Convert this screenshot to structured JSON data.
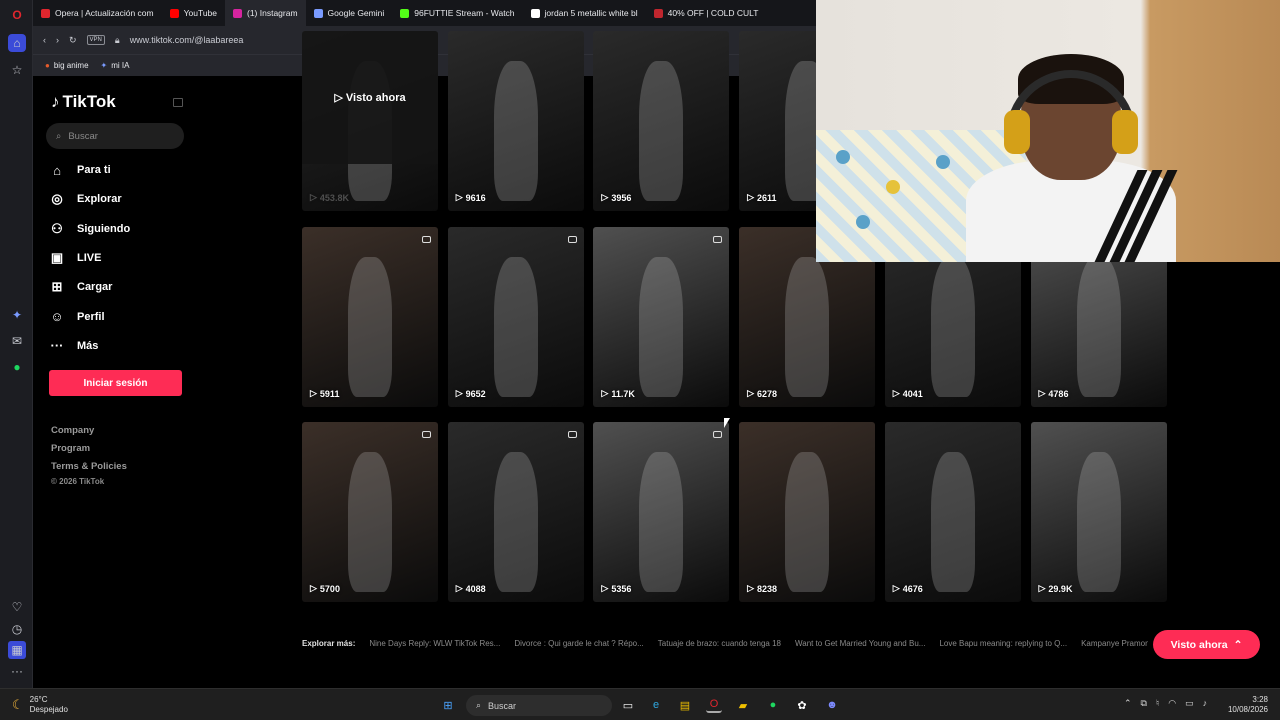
{
  "browser": {
    "tabs": [
      {
        "title": "Opera | Actualización com",
        "color": "#e0262e"
      },
      {
        "title": "YouTube",
        "color": "#ff0000"
      },
      {
        "title": "(1) Instagram",
        "color": "#d6249f"
      },
      {
        "title": "Google Gemini",
        "color": "#7a9bff"
      },
      {
        "title": "96FUTTIE Stream - Watch",
        "color": "#53fc18"
      },
      {
        "title": "jordan 5 metallic white bl",
        "color": "#ffffff"
      },
      {
        "title": "40% OFF | COLD CULT",
        "color": "#c0262e"
      }
    ],
    "url": "www.tiktok.com/@laabareea",
    "vpn_label": "VPN",
    "bookmarks": [
      "big anime",
      "mi IA"
    ]
  },
  "tiktok": {
    "logo": "TikTok",
    "search_placeholder": "Buscar",
    "nav": [
      {
        "label": "Para ti",
        "icon": "home-icon",
        "glyph": "⌂"
      },
      {
        "label": "Explorar",
        "icon": "compass-icon",
        "glyph": "◎"
      },
      {
        "label": "Siguiendo",
        "icon": "following-icon",
        "glyph": "⚇"
      },
      {
        "label": "LIVE",
        "icon": "live-icon",
        "glyph": "▣"
      },
      {
        "label": "Cargar",
        "icon": "upload-icon",
        "glyph": "⊞"
      },
      {
        "label": "Perfil",
        "icon": "profile-icon",
        "glyph": "☺"
      },
      {
        "label": "Más",
        "icon": "more-icon",
        "glyph": "···"
      }
    ],
    "login_label": "Iniciar sesión",
    "footer": [
      "Company",
      "Program",
      "Terms & Policies"
    ],
    "copyright": "© 2026 TikTok"
  },
  "videos": {
    "watched_label": "Visto ahora",
    "row1": [
      {
        "views": "453.8K",
        "watched": true
      },
      {
        "views": "9616"
      },
      {
        "views": "3956"
      },
      {
        "views": "2611"
      }
    ],
    "row2": [
      {
        "views": "5911"
      },
      {
        "views": "9652"
      },
      {
        "views": "11.7K"
      },
      {
        "views": "6278"
      },
      {
        "views": "4041"
      },
      {
        "views": "4786"
      }
    ],
    "row3": [
      {
        "views": "5700"
      },
      {
        "views": "4088"
      },
      {
        "views": "5356"
      },
      {
        "views": "8238"
      },
      {
        "views": "4676"
      },
      {
        "views": "29.9K"
      }
    ]
  },
  "explore": {
    "label": "Explorar más:",
    "items": [
      "Nine Days Reply: WLW TikTok Res...",
      "Divorce : Qui garde le chat ? Répo...",
      "Tatuaje de brazo: cuando tenga 18",
      "Want to Get Married Young and Bu...",
      "Love Bapu meaning: replying to Q...",
      "Kampanye Pramono"
    ]
  },
  "watch_now_pill": "Visto ahora",
  "taskbar": {
    "temperature": "26°C",
    "weather": "Despejado",
    "search": "Buscar",
    "time": "3:28",
    "date": "10/08/2026"
  }
}
